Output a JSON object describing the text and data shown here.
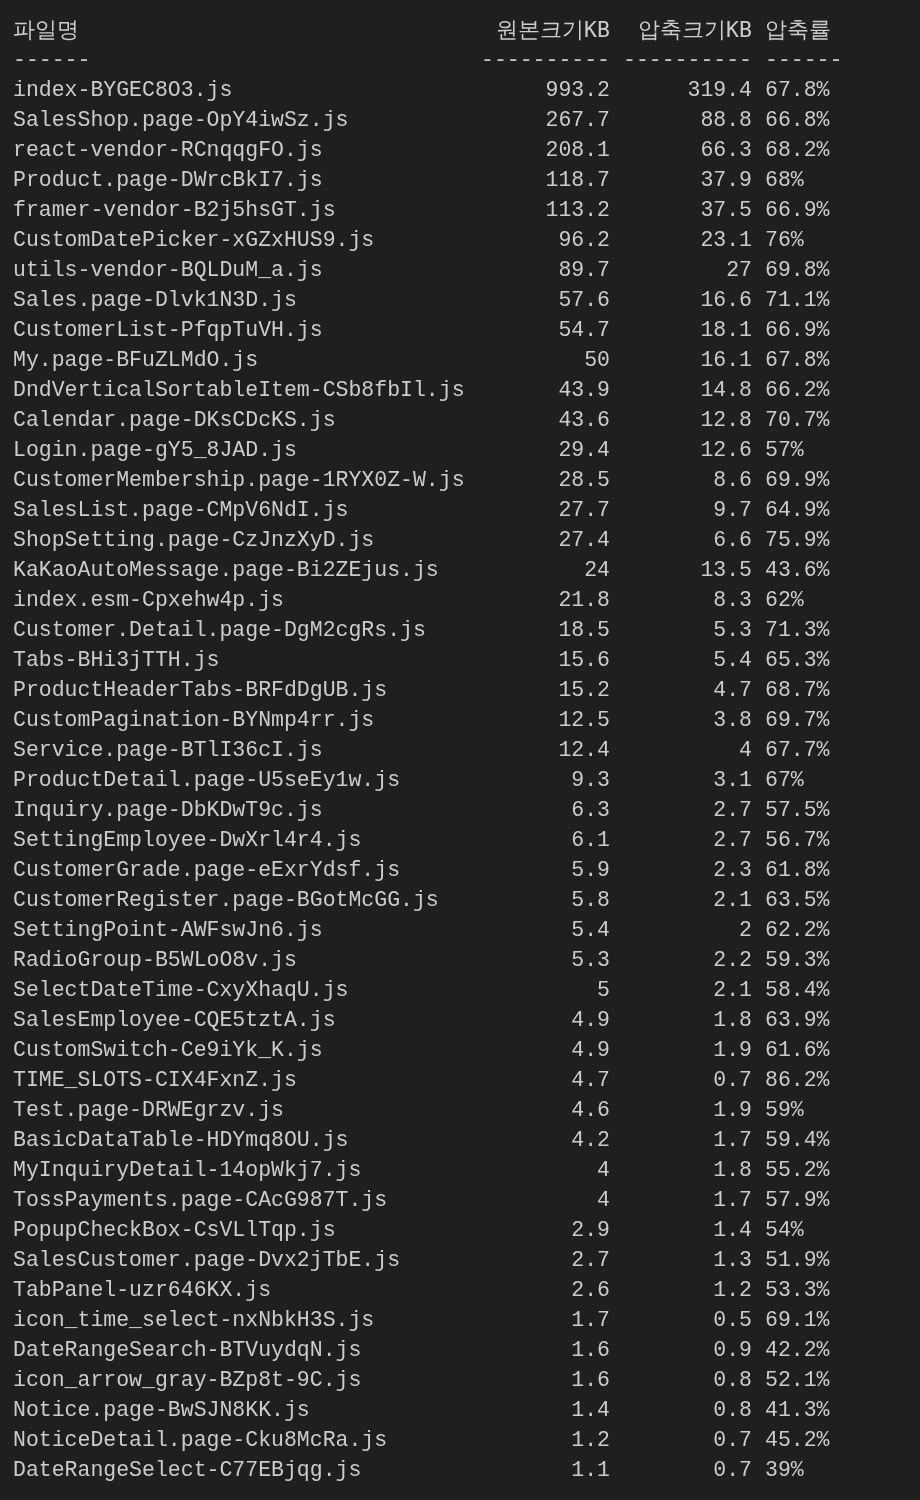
{
  "table": {
    "columns": [
      {
        "label": "파일명",
        "rule": "------"
      },
      {
        "label": "원본크기KB",
        "rule": "----------"
      },
      {
        "label": "압축크기KB",
        "rule": "----------"
      },
      {
        "label": "압축률",
        "rule": "------"
      }
    ],
    "rows": [
      [
        "index-BYGEC8O3.js",
        "993.2",
        "319.4",
        "67.8%"
      ],
      [
        "SalesShop.page-OpY4iwSz.js",
        "267.7",
        "88.8",
        "66.8%"
      ],
      [
        "react-vendor-RCnqqgFO.js",
        "208.1",
        "66.3",
        "68.2%"
      ],
      [
        "Product.page-DWrcBkI7.js",
        "118.7",
        "37.9",
        "68%"
      ],
      [
        "framer-vendor-B2j5hsGT.js",
        "113.2",
        "37.5",
        "66.9%"
      ],
      [
        "CustomDatePicker-xGZxHUS9.js",
        "96.2",
        "23.1",
        "76%"
      ],
      [
        "utils-vendor-BQLDuM_a.js",
        "89.7",
        "27",
        "69.8%"
      ],
      [
        "Sales.page-Dlvk1N3D.js",
        "57.6",
        "16.6",
        "71.1%"
      ],
      [
        "CustomerList-PfqpTuVH.js",
        "54.7",
        "18.1",
        "66.9%"
      ],
      [
        "My.page-BFuZLMdO.js",
        "50",
        "16.1",
        "67.8%"
      ],
      [
        "DndVerticalSortableItem-CSb8fbIl.js",
        "43.9",
        "14.8",
        "66.2%"
      ],
      [
        "Calendar.page-DKsCDcKS.js",
        "43.6",
        "12.8",
        "70.7%"
      ],
      [
        "Login.page-gY5_8JAD.js",
        "29.4",
        "12.6",
        "57%"
      ],
      [
        "CustomerMembership.page-1RYX0Z-W.js",
        "28.5",
        "8.6",
        "69.9%"
      ],
      [
        "SalesList.page-CMpV6NdI.js",
        "27.7",
        "9.7",
        "64.9%"
      ],
      [
        "ShopSetting.page-CzJnzXyD.js",
        "27.4",
        "6.6",
        "75.9%"
      ],
      [
        "KaKaoAutoMessage.page-Bi2ZEjus.js",
        "24",
        "13.5",
        "43.6%"
      ],
      [
        "index.esm-Cpxehw4p.js",
        "21.8",
        "8.3",
        "62%"
      ],
      [
        "Customer.Detail.page-DgM2cgRs.js",
        "18.5",
        "5.3",
        "71.3%"
      ],
      [
        "Tabs-BHi3jTTH.js",
        "15.6",
        "5.4",
        "65.3%"
      ],
      [
        "ProductHeaderTabs-BRFdDgUB.js",
        "15.2",
        "4.7",
        "68.7%"
      ],
      [
        "CustomPagination-BYNmp4rr.js",
        "12.5",
        "3.8",
        "69.7%"
      ],
      [
        "Service.page-BTlI36cI.js",
        "12.4",
        "4",
        "67.7%"
      ],
      [
        "ProductDetail.page-U5seEy1w.js",
        "9.3",
        "3.1",
        "67%"
      ],
      [
        "Inquiry.page-DbKDwT9c.js",
        "6.3",
        "2.7",
        "57.5%"
      ],
      [
        "SettingEmployee-DwXrl4r4.js",
        "6.1",
        "2.7",
        "56.7%"
      ],
      [
        "CustomerGrade.page-eExrYdsf.js",
        "5.9",
        "2.3",
        "61.8%"
      ],
      [
        "CustomerRegister.page-BGotMcGG.js",
        "5.8",
        "2.1",
        "63.5%"
      ],
      [
        "SettingPoint-AWFswJn6.js",
        "5.4",
        "2",
        "62.2%"
      ],
      [
        "RadioGroup-B5WLoO8v.js",
        "5.3",
        "2.2",
        "59.3%"
      ],
      [
        "SelectDateTime-CxyXhaqU.js",
        "5",
        "2.1",
        "58.4%"
      ],
      [
        "SalesEmployee-CQE5tztA.js",
        "4.9",
        "1.8",
        "63.9%"
      ],
      [
        "CustomSwitch-Ce9iYk_K.js",
        "4.9",
        "1.9",
        "61.6%"
      ],
      [
        "TIME_SLOTS-CIX4FxnZ.js",
        "4.7",
        "0.7",
        "86.2%"
      ],
      [
        "Test.page-DRWEgrzv.js",
        "4.6",
        "1.9",
        "59%"
      ],
      [
        "BasicDataTable-HDYmq8OU.js",
        "4.2",
        "1.7",
        "59.4%"
      ],
      [
        "MyInquiryDetail-14opWkj7.js",
        "4",
        "1.8",
        "55.2%"
      ],
      [
        "TossPayments.page-CAcG987T.js",
        "4",
        "1.7",
        "57.9%"
      ],
      [
        "PopupCheckBox-CsVLlTqp.js",
        "2.9",
        "1.4",
        "54%"
      ],
      [
        "SalesCustomer.page-Dvx2jTbE.js",
        "2.7",
        "1.3",
        "51.9%"
      ],
      [
        "TabPanel-uzr646KX.js",
        "2.6",
        "1.2",
        "53.3%"
      ],
      [
        "icon_time_select-nxNbkH3S.js",
        "1.7",
        "0.5",
        "69.1%"
      ],
      [
        "DateRangeSearch-BTVuydqN.js",
        "1.6",
        "0.9",
        "42.2%"
      ],
      [
        "icon_arrow_gray-BZp8t-9C.js",
        "1.6",
        "0.8",
        "52.1%"
      ],
      [
        "Notice.page-BwSJN8KK.js",
        "1.4",
        "0.8",
        "41.3%"
      ],
      [
        "NoticeDetail.page-Cku8McRa.js",
        "1.2",
        "0.7",
        "45.2%"
      ],
      [
        "DateRangeSelect-C77EBjqg.js",
        "1.1",
        "0.7",
        "39%"
      ]
    ]
  }
}
